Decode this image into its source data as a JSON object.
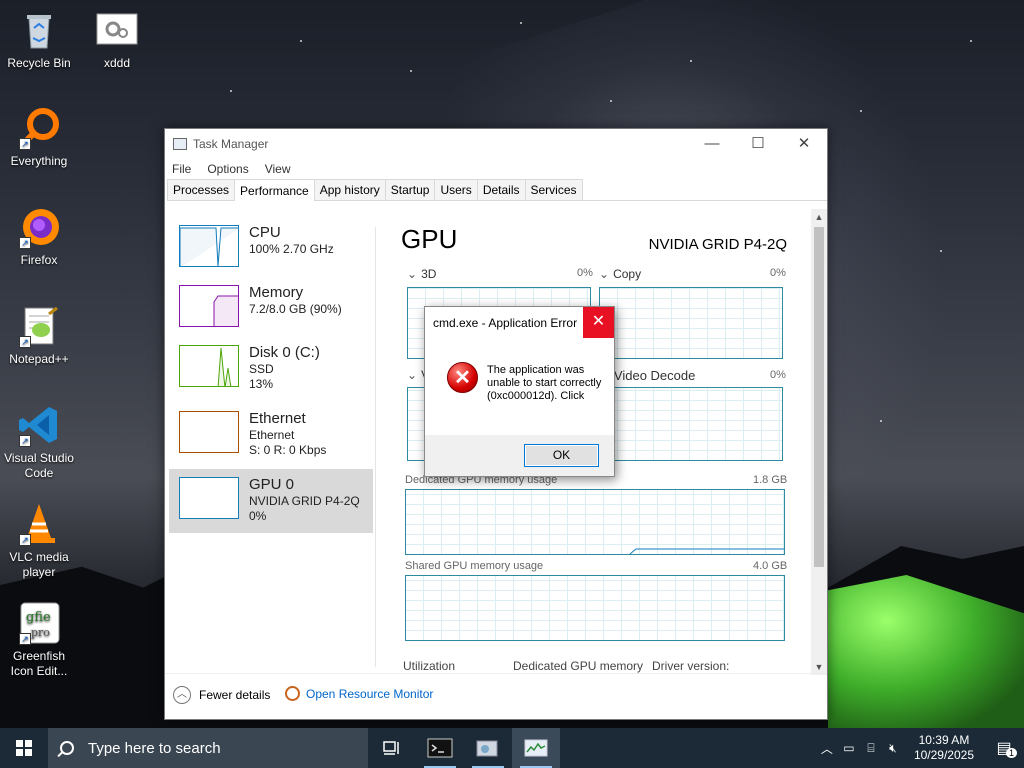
{
  "desktop": {
    "icons": [
      {
        "label": "Recycle Bin",
        "icon": "recycle-bin-icon"
      },
      {
        "label": "xddd",
        "icon": "settings-file-icon"
      },
      {
        "label": "Everything",
        "icon": "everything-search-icon"
      },
      {
        "label": "Firefox",
        "icon": "firefox-icon"
      },
      {
        "label": "Notepad++",
        "icon": "notepad-plus-plus-icon"
      },
      {
        "label": "Visual Studio Code",
        "icon": "vscode-icon"
      },
      {
        "label": "VLC media player",
        "icon": "vlc-icon"
      },
      {
        "label": "Greenfish Icon Edit...",
        "icon": "greenfish-icon"
      }
    ]
  },
  "task_manager": {
    "title": "Task Manager",
    "menu": [
      "File",
      "Options",
      "View"
    ],
    "tabs": [
      "Processes",
      "Performance",
      "App history",
      "Startup",
      "Users",
      "Details",
      "Services"
    ],
    "active_tab": "Performance",
    "sidebar": [
      {
        "name": "CPU",
        "line1": "100% 2.70 GHz",
        "line2": "",
        "line3": "",
        "color": "#117dbb"
      },
      {
        "name": "Memory",
        "line1": "7.2/8.0 GB (90%)",
        "line2": "",
        "line3": "",
        "color": "#8b12ae"
      },
      {
        "name": "Disk 0 (C:)",
        "line1": "SSD",
        "line2": "13%",
        "line3": "",
        "color": "#4da60c"
      },
      {
        "name": "Ethernet",
        "line1": "Ethernet",
        "line2": "S: 0 R: 0 Kbps",
        "line3": "",
        "color": "#a74f01"
      },
      {
        "name": "GPU 0",
        "line1": "NVIDIA GRID P4-2Q",
        "line2": "0%",
        "line3": "",
        "color": "#117dbb"
      }
    ],
    "selected_item": "GPU 0",
    "gpu": {
      "heading": "GPU",
      "model": "NVIDIA GRID P4-2Q",
      "engines": [
        {
          "name": "3D",
          "value": "0%"
        },
        {
          "name": "Copy",
          "value": "0%"
        },
        {
          "name": "V",
          "value": ""
        },
        {
          "name": "Video Decode",
          "value": "0%"
        }
      ],
      "dedicated_label": "Dedicated GPU memory usage",
      "dedicated_max": "1.8 GB",
      "shared_label": "Shared GPU memory usage",
      "shared_max": "4.0 GB",
      "bottom_labels": [
        "Utilization",
        "Dedicated GPU memory",
        "Driver version:"
      ]
    },
    "footer": {
      "fewer_details": "Fewer details",
      "open_resource_monitor": "Open Resource Monitor"
    }
  },
  "error_dialog": {
    "title": "cmd.exe - Application Error",
    "message": "The application was unable to start correctly (0xc000012d). Click",
    "ok": "OK"
  },
  "taskbar": {
    "search_placeholder": "Type here to search",
    "time": "10:39 AM",
    "date": "10/29/2025",
    "notification_count": "1"
  }
}
